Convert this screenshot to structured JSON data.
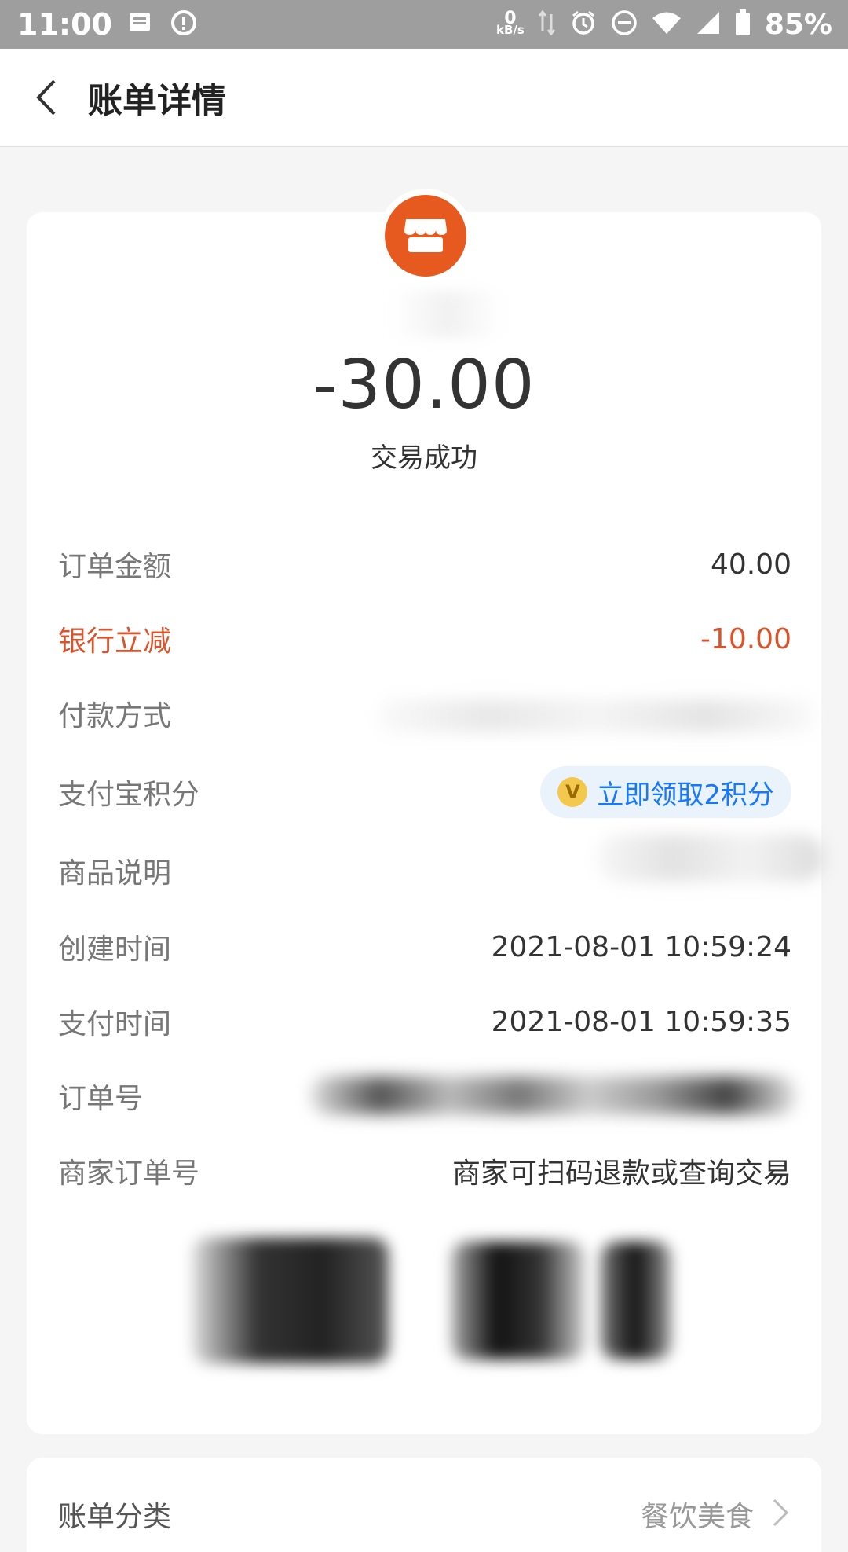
{
  "status_bar": {
    "time": "11:00",
    "net_speed_value": "0",
    "net_speed_unit": "kB/s",
    "battery": "85%"
  },
  "nav": {
    "title": "账单详情"
  },
  "transaction": {
    "amount": "-30.00",
    "status": "交易成功"
  },
  "details": [
    {
      "label": "订单金额",
      "value": "40.00"
    },
    {
      "label": "银行立减",
      "value": "-10.00"
    },
    {
      "label": "付款方式",
      "value": ""
    },
    {
      "label": "支付宝积分",
      "value": "立即领取2积分"
    },
    {
      "label": "商品说明",
      "value": ""
    },
    {
      "label": "创建时间",
      "value": "2021-08-01 10:59:24"
    },
    {
      "label": "支付时间",
      "value": "2021-08-01 10:59:35"
    },
    {
      "label": "订单号",
      "value": ""
    },
    {
      "label": "商家订单号",
      "value": "商家可扫码退款或查询交易"
    }
  ],
  "points_coin_glyph": "V",
  "bill_category": {
    "label": "账单分类",
    "value": "餐饮美食"
  },
  "colors": {
    "accent_red": "#d9532b",
    "merchant_icon": "#e75a1f",
    "link_blue": "#1677ff"
  }
}
